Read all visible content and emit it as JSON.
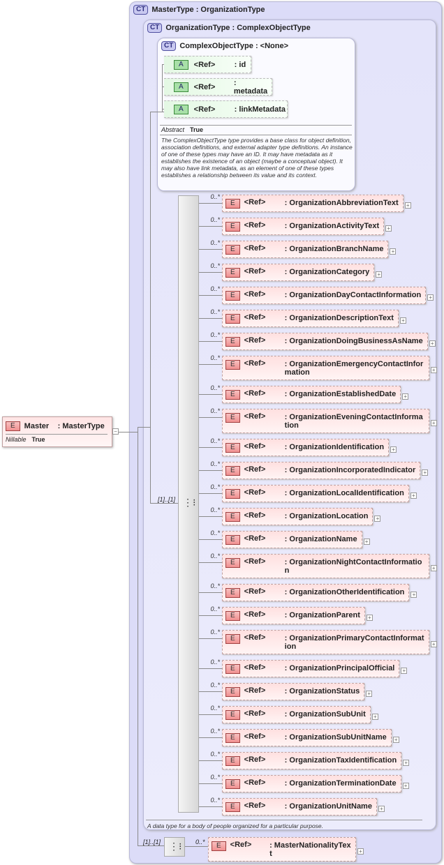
{
  "master": {
    "badge": "E",
    "name": "Master",
    "type": ": MasterType",
    "prop_label": "Nillable",
    "prop_value": "True",
    "collapse": "−"
  },
  "outer": {
    "badge": "CT",
    "title": "MasterType : OrganizationType",
    "seq_card": "[1]..[1]"
  },
  "mid": {
    "badge": "CT",
    "title": "OrganizationType : ComplexObjectType",
    "seq_card": "[1]..[1]",
    "description": "A data type for a body of people organized for a particular purpose."
  },
  "inner": {
    "badge": "CT",
    "title": "ComplexObjectType : <None>",
    "abstract_label": "Abstract",
    "abstract_value": "True",
    "description": "The ComplexObjectType type provides a base class for object definition, association definitions, and external adapter type definitions. An instance of one of these types may have an ID. It may have metadata as it establishes the existence of an object (maybe a conceptual object). It may also have link metadata, as an element of one of these types establishes a relationship between its value and its context.",
    "attributes": [
      {
        "badge": "A",
        "ref": "<Ref>",
        "name": ": id"
      },
      {
        "badge": "A",
        "ref": "<Ref>",
        "name": ": metadata"
      },
      {
        "badge": "A",
        "ref": "<Ref>",
        "name": ": linkMetadata"
      }
    ]
  },
  "elements": [
    "OrganizationAbbreviationText",
    "OrganizationActivityText",
    "OrganizationBranchName",
    "OrganizationCategory",
    "OrganizationDayContactInformation",
    "OrganizationDescriptionText",
    "OrganizationDoingBusinessAsName",
    "OrganizationEmergencyContactInformation",
    "OrganizationEstablishedDate",
    "OrganizationEveningContactInformation",
    "OrganizationIdentification",
    "OrganizationIncorporatedIndicator",
    "OrganizationLocalIdentification",
    "OrganizationLocation",
    "OrganizationName",
    "OrganizationNightContactInformation",
    "OrganizationOtherIdentification",
    "OrganizationParent",
    "OrganizationPrimaryContactInformation",
    "OrganizationPrincipalOfficial",
    "OrganizationStatus",
    "OrganizationSubUnit",
    "OrganizationSubUnitName",
    "OrganizationTaxIdentification",
    "OrganizationTerminationDate",
    "OrganizationUnitName"
  ],
  "element_common": {
    "badge": "E",
    "ref": "<Ref>",
    "cardinality": "0..*",
    "expand": "+"
  },
  "nationality": {
    "badge": "E",
    "ref": "<Ref>",
    "name": ": MasterNationalityText",
    "cardinality": "0..*",
    "expand": "+"
  }
}
